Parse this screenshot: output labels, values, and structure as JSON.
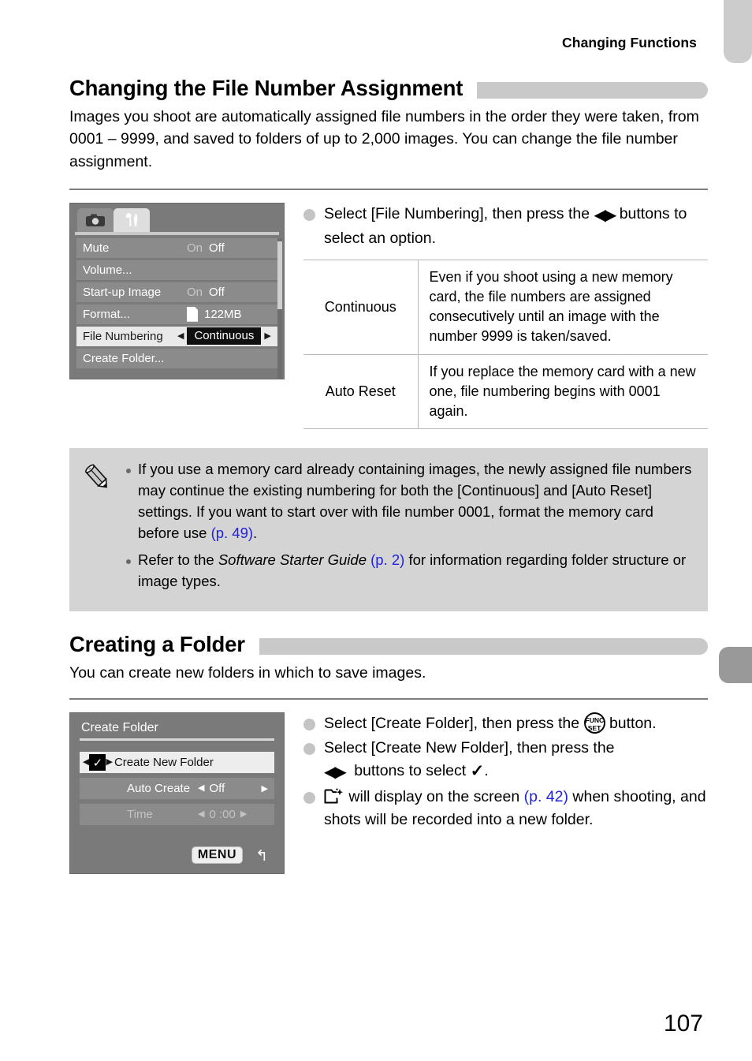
{
  "running_head": "Changing Functions",
  "page_number": "107",
  "section1": {
    "title": "Changing the File Number Assignment",
    "intro": "Images you shoot are automatically assigned file numbers in the order they were taken, from 0001 – 9999, and saved to folders of up to 2,000 images. You can change the file number assignment.",
    "screen": {
      "tabs": [
        {
          "icon": "camera-icon",
          "state": "inactive"
        },
        {
          "icon": "wrench-tools-icon",
          "state": "active"
        }
      ],
      "rows": [
        {
          "label": "Mute",
          "value_on": "On",
          "value_off": "Off",
          "selected_value": "Off"
        },
        {
          "label": "Volume...",
          "value_on": "",
          "value_off": "",
          "selected_value": ""
        },
        {
          "label": "Start-up Image",
          "value_on": "On",
          "value_off": "Off",
          "selected_value": "Off"
        },
        {
          "label": "Format...",
          "value_on": "",
          "value_off": "122MB",
          "selected_value": "122MB"
        },
        {
          "label": "File Numbering",
          "value_on": "",
          "value_off": "",
          "selected_value": "Continuous"
        },
        {
          "label": "Create Folder...",
          "value_on": "",
          "value_off": "",
          "selected_value": ""
        }
      ]
    },
    "step": "Select [File Numbering], then press the ◀▶ buttons to select an option.",
    "step_pre": "Select [File Numbering], then press the",
    "step_post": "buttons to select an option.",
    "table": {
      "rows": [
        {
          "name": "Continuous",
          "desc": "Even if you shoot using a new memory card, the file numbers are assigned consecutively until an image with the number 9999 is taken/saved."
        },
        {
          "name": "Auto Reset",
          "desc": "If you replace the memory card with a new one, file numbering begins with 0001 again."
        }
      ]
    },
    "notes": [
      {
        "text_a": "If you use a memory card already containing images, the newly assigned file numbers may continue the existing numbering for both the [Continuous] and [Auto Reset] settings. If you want to start over with file number 0001, format the memory card before use ",
        "link": "(p. 49)",
        "text_b": "."
      },
      {
        "text_a": "Refer to the ",
        "italic": "Software Starter Guide",
        "link": " (p. 2)",
        "text_b": " for information regarding folder structure or image types."
      }
    ]
  },
  "section2": {
    "title": "Creating a Folder",
    "intro": "You can create new folders in which to save images.",
    "screen": {
      "title": "Create Folder",
      "rows": [
        {
          "label": "Create New Folder",
          "value": "✓",
          "state": "selected"
        },
        {
          "label": "Auto Create",
          "value": "Off",
          "state": "normal"
        },
        {
          "label": "Time",
          "value": "0 :00",
          "state": "dimmed"
        }
      ],
      "menu_button": "MENU",
      "back_icon": "back-arrow-icon"
    },
    "steps": [
      {
        "pre": "Select [Create Folder], then press the",
        "icon": "func-set-button-icon",
        "post": "button."
      },
      {
        "pre": "Select [Create New Folder], then press the",
        "icon": "left-right-arrows-icon",
        "mid": "buttons to select",
        "icon2": "checkmark-icon",
        "post": "."
      },
      {
        "icon": "new-folder-icon",
        "pre": "will display on the screen",
        "link": "(p. 42)",
        "post": "when shooting, and shots will be recorded into a new folder."
      }
    ]
  },
  "colors": {
    "accent_link": "#2222dd",
    "head_bar": "#c9c9c9",
    "note_bg": "#d4d4d4",
    "lcd_bg": "#7a7a7a",
    "tab_light": "#cccccc",
    "tab_dark": "#999999"
  }
}
